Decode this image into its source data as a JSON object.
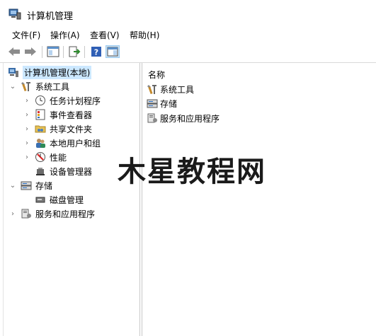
{
  "window": {
    "title": "计算机管理"
  },
  "menu": {
    "items": [
      "文件(F)",
      "操作(A)",
      "查看(V)",
      "帮助(H)"
    ]
  },
  "toolbar": {
    "buttons": [
      "back-icon",
      "forward-icon",
      "show-hide-console-tree-icon",
      "export-list-icon",
      "help-icon",
      "show-hide-action-pane-icon"
    ]
  },
  "tree": {
    "root": "计算机管理(本地)",
    "system_tools": "系统工具",
    "task_scheduler": "任务计划程序",
    "event_viewer": "事件查看器",
    "shared_folders": "共享文件夹",
    "local_users": "本地用户和组",
    "performance": "性能",
    "device_manager": "设备管理器",
    "storage": "存储",
    "disk_management": "磁盘管理",
    "services_apps": "服务和应用程序"
  },
  "list": {
    "header": "名称",
    "items": [
      "系统工具",
      "存储",
      "服务和应用程序"
    ]
  },
  "watermark": "木星教程网"
}
